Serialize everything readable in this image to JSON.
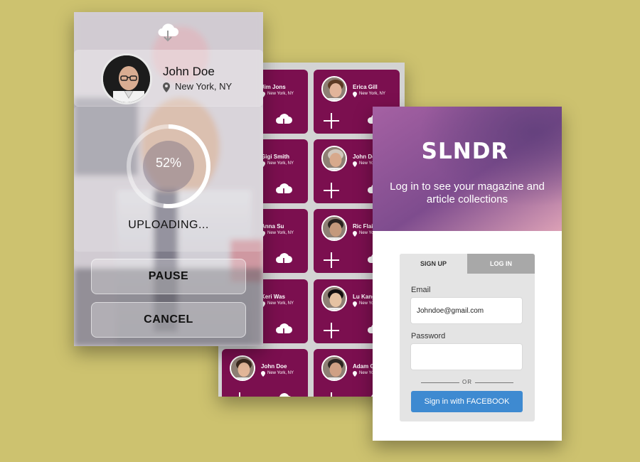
{
  "upload": {
    "name": "John Doe",
    "location": "New York, NY",
    "progress": 0.52,
    "progress_label": "52%",
    "status": "UPLOADING...",
    "pause_label": "PAUSE",
    "cancel_label": "CANCEL"
  },
  "contacts": [
    {
      "name": "Jim Jons",
      "location": "New York, NY",
      "skin": "#b8896b",
      "hair": "#3a2a1e"
    },
    {
      "name": "Erica Gill",
      "location": "New York, NY",
      "skin": "#e1b49a",
      "hair": "#5c3a24"
    },
    {
      "name": "Gigi Smith",
      "location": "New York, NY",
      "skin": "#d9a98a",
      "hair": "#2b1d14"
    },
    {
      "name": "John Doe",
      "location": "New York, NY",
      "skin": "#d7a98c",
      "hair": "#d0c7bd"
    },
    {
      "name": "Anna Su",
      "location": "New York, NY",
      "skin": "#e3c1a4",
      "hair": "#1e1612"
    },
    {
      "name": "Ric Flairr",
      "location": "New York, NY",
      "skin": "#c4997c",
      "hair": "#2a2320"
    },
    {
      "name": "Keri Was",
      "location": "New York, NY",
      "skin": "#dcae8f",
      "hair": "#6b4a30"
    },
    {
      "name": "Lu Kang",
      "location": "New York, NY",
      "skin": "#e5c2a2",
      "hair": "#141010"
    },
    {
      "name": "John Doe",
      "location": "New York, NY",
      "skin": "#e3b698",
      "hair": "#3b2a1e"
    },
    {
      "name": "Adam Gill",
      "location": "New York, NY",
      "skin": "#cfa084",
      "hair": "#2c2622"
    }
  ],
  "login": {
    "logo": "SLNDR",
    "tagline_line1": "Log in to see your magazine and",
    "tagline_line2": "article collections",
    "tab_signup": "SIGN UP",
    "tab_login": "LOG IN",
    "email_label": "Email",
    "email_value": "Johndoe@gmail.com",
    "password_label": "Password",
    "password_value": "",
    "or_label": "OR",
    "facebook_label": "Sign in with FACEBOOK"
  },
  "colors": {
    "background": "#cdc26f",
    "card": "#7b0f4f",
    "facebook": "#3e8ad1",
    "header_start": "#a45fa2",
    "header_end": "#dba0b6"
  }
}
